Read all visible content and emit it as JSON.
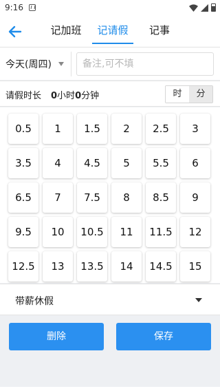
{
  "status": {
    "time": "9:16"
  },
  "tabs": [
    {
      "label": "记加班"
    },
    {
      "label": "记请假"
    },
    {
      "label": "记事"
    }
  ],
  "form": {
    "day": "今天(周四)",
    "note_placeholder": "备注,可不填",
    "duration_label": "请假时长",
    "duration_hours": "0",
    "hours_unit": "小时",
    "duration_minutes": "0",
    "minutes_unit": "分钟",
    "unit_options": [
      "时",
      "分"
    ],
    "selected_unit": "分",
    "leave_type": "带薪休假"
  },
  "grid_values": [
    "0.5",
    "1",
    "1.5",
    "2",
    "2.5",
    "3",
    "3.5",
    "4",
    "4.5",
    "5",
    "5.5",
    "6",
    "6.5",
    "7",
    "7.5",
    "8",
    "8.5",
    "9",
    "9.5",
    "10",
    "10.5",
    "11",
    "11.5",
    "12",
    "12.5",
    "13",
    "13.5",
    "14",
    "14.5",
    "15"
  ],
  "buttons": {
    "delete": "删除",
    "save": "保存"
  },
  "colors": {
    "accent": "#1f8cea",
    "button": "#2b90f0"
  }
}
